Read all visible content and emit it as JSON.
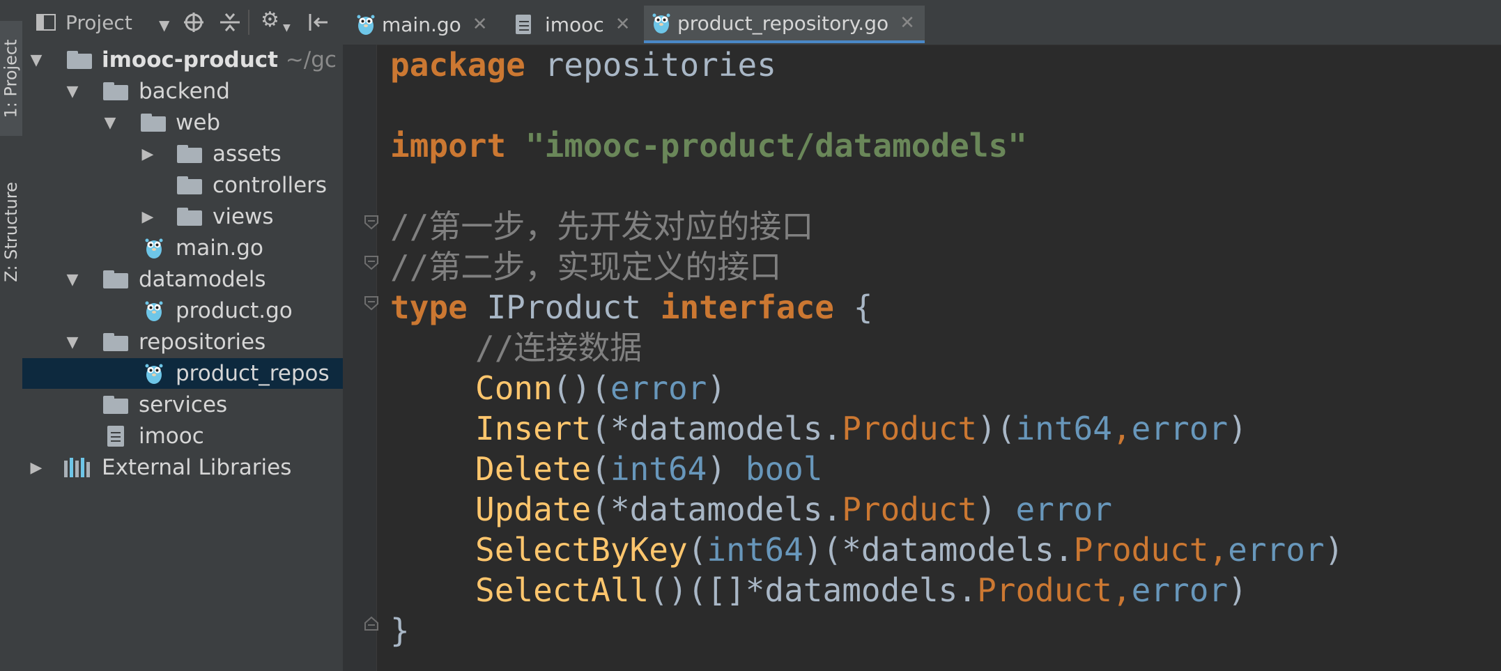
{
  "tool_window_tabs": [
    {
      "label": "1: Project"
    },
    {
      "label": "Z: Structure"
    }
  ],
  "project_panel": {
    "title": "Project",
    "header_icons": [
      "dropdown-arrow-icon",
      "target-icon",
      "collapse-all-icon",
      "gear-icon",
      "hide-icon"
    ],
    "tree": [
      {
        "label": "imooc-product",
        "suffix": "~/gc",
        "type": "folder",
        "expanded": true
      },
      {
        "label": "backend",
        "type": "folder",
        "expanded": true
      },
      {
        "label": "web",
        "type": "folder",
        "expanded": true
      },
      {
        "label": "assets",
        "type": "folder",
        "expanded": false
      },
      {
        "label": "controllers",
        "type": "folder"
      },
      {
        "label": "views",
        "type": "folder",
        "expanded": false
      },
      {
        "label": "main.go",
        "type": "go-file"
      },
      {
        "label": "datamodels",
        "type": "folder",
        "expanded": true
      },
      {
        "label": "product.go",
        "type": "go-file"
      },
      {
        "label": "repositories",
        "type": "folder",
        "expanded": true
      },
      {
        "label": "product_repos",
        "type": "go-file",
        "selected": true
      },
      {
        "label": "services",
        "type": "folder"
      },
      {
        "label": "imooc",
        "type": "file"
      },
      {
        "label": "External Libraries",
        "type": "library",
        "expanded": false
      }
    ]
  },
  "editor": {
    "tabs": [
      {
        "label": "main.go",
        "icon": "gopher-icon"
      },
      {
        "label": "imooc",
        "icon": "file-icon"
      },
      {
        "label": "product_repository.go",
        "icon": "gopher-icon",
        "active": true
      }
    ],
    "code": {
      "kw_package": "package",
      "pkg_name": "repositories",
      "kw_import": "import",
      "import_path": "\"imooc-product/datamodels\"",
      "comment1": "//第一步，先开发对应的接口",
      "comment2": "//第二步，实现定义的接口",
      "kw_type": "type",
      "iface_name": "IProduct",
      "kw_interface": "interface",
      "open_brace": "{",
      "comment3": "//连接数据",
      "m_conn": "Conn",
      "m_insert": "Insert",
      "m_delete": "Delete",
      "m_update": "Update",
      "m_selectbykey": "SelectByKey",
      "m_selectall": "SelectAll",
      "t_error": "error",
      "t_int64": "int64",
      "t_bool": "bool",
      "pkg_ref": "datamodels.",
      "t_product": "Product",
      "close_brace": "}"
    }
  },
  "colors": {
    "keyword": "#cc7832",
    "string": "#6a8759",
    "comment": "#808080",
    "function": "#ffc66d",
    "primitive": "#6897bb",
    "text": "#a9b7c6",
    "selection": "#0d293e",
    "active_tab_underline": "#4a88c7"
  }
}
